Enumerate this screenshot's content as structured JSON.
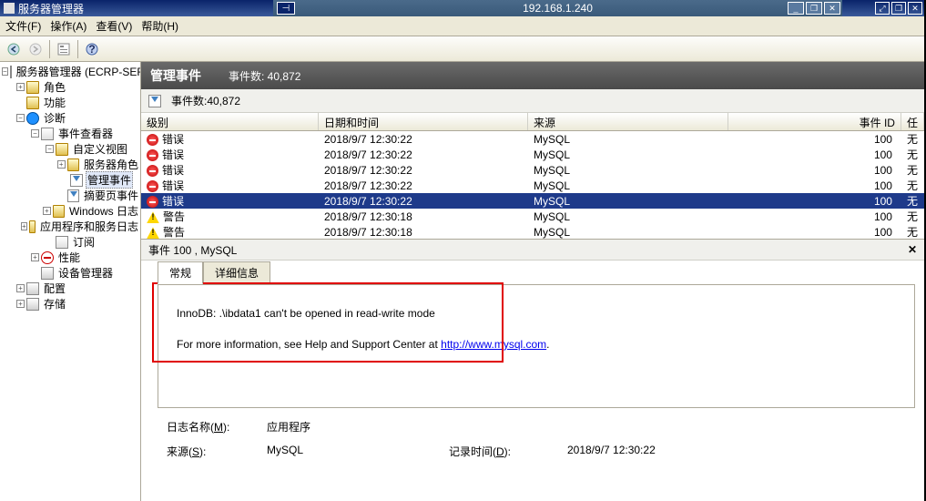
{
  "titlebar": {
    "app_title": "服务器管理器",
    "ip": "192.168.1.240"
  },
  "menu": {
    "file": "文件(F)",
    "action": "操作(A)",
    "view": "查看(V)",
    "help": "帮助(H)"
  },
  "tree": {
    "root": "服务器管理器 (ECRP-SERVER)",
    "roles": "角色",
    "features": "功能",
    "diag": "诊断",
    "eventviewer": "事件查看器",
    "customviews": "自定义视图",
    "serverroles": "服务器角色",
    "adminevents": "管理事件",
    "summaryevents": "摘要页事件",
    "winlogs": "Windows 日志",
    "appservlogs": "应用程序和服务日志",
    "subscriptions": "订阅",
    "perf": "性能",
    "devmgr": "设备管理器",
    "config": "配置",
    "storage": "存储"
  },
  "header": {
    "title": "管理事件",
    "count_label": "事件数:",
    "count": "40,872"
  },
  "filterbar": {
    "count_label": "事件数:",
    "count": "40,872"
  },
  "columns": {
    "level": "级别",
    "datetime": "日期和时间",
    "source": "来源",
    "eventid": "事件 ID",
    "category": "任务类别"
  },
  "events": [
    {
      "icon": "err",
      "level": "错误",
      "datetime": "2018/9/7 12:30:22",
      "source": "MySQL",
      "id": "100",
      "cat": "无",
      "sel": false
    },
    {
      "icon": "err",
      "level": "错误",
      "datetime": "2018/9/7 12:30:22",
      "source": "MySQL",
      "id": "100",
      "cat": "无",
      "sel": false
    },
    {
      "icon": "err",
      "level": "错误",
      "datetime": "2018/9/7 12:30:22",
      "source": "MySQL",
      "id": "100",
      "cat": "无",
      "sel": false
    },
    {
      "icon": "err",
      "level": "错误",
      "datetime": "2018/9/7 12:30:22",
      "source": "MySQL",
      "id": "100",
      "cat": "无",
      "sel": false
    },
    {
      "icon": "err",
      "level": "错误",
      "datetime": "2018/9/7 12:30:22",
      "source": "MySQL",
      "id": "100",
      "cat": "无",
      "sel": true
    },
    {
      "icon": "warn",
      "level": "警告",
      "datetime": "2018/9/7 12:30:18",
      "source": "MySQL",
      "id": "100",
      "cat": "无",
      "sel": false
    },
    {
      "icon": "warn",
      "level": "警告",
      "datetime": "2018/9/7 12:30:18",
      "source": "MySQL",
      "id": "100",
      "cat": "无",
      "sel": false
    }
  ],
  "detail": {
    "header": "事件 100 , MySQL",
    "tab_general": "常规",
    "tab_detail": "详细信息",
    "message": "InnoDB: .\\ibdata1 can't be opened in read-write mode",
    "moreinfo_prefix": "For more information, see Help and Support Center at ",
    "moreinfo_link": "http://www.mysql.com",
    "moreinfo_suffix": ".",
    "log_label": "日志名称(M):",
    "log_value": "应用程序",
    "src_label": "来源(S):",
    "src_value": "MySQL",
    "time_label": "记录时间(D):",
    "time_value": "2018/9/7 12:30:22"
  }
}
